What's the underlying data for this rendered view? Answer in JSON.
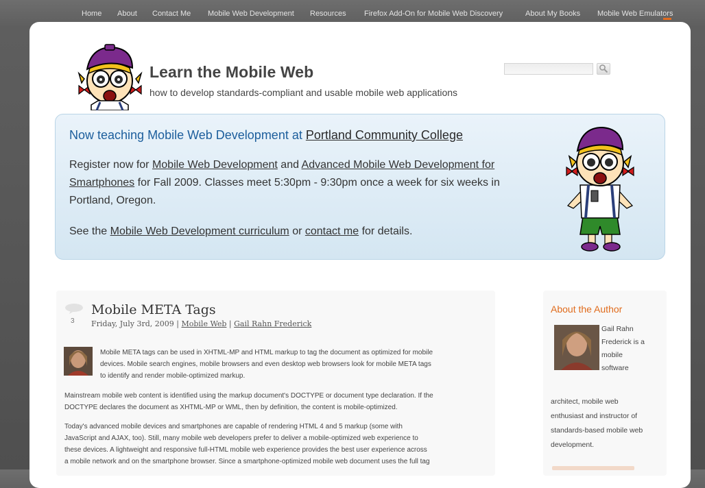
{
  "nav": {
    "home": "Home",
    "about": "About",
    "contact": "Contact Me",
    "mobile_dev": "Mobile Web Development",
    "resources": "Resources",
    "firefox": "Firefox Add-On for Mobile Web Discovery",
    "books": "About My Books",
    "emulators": "Mobile Web Emulators"
  },
  "header": {
    "title": "Learn the Mobile Web",
    "tagline": "how to develop standards-compliant and usable mobile web applications",
    "search_placeholder": ""
  },
  "promo": {
    "title_prefix": "Now teaching Mobile Web Development at ",
    "title_link": "Portland Community College",
    "p1_a": "Register now for ",
    "p1_link1": "Mobile Web Development",
    "p1_b": " and ",
    "p1_link2": "Advanced Mobile Web Development for Smartphones",
    "p1_c": " for Fall 2009. Classes meet 5:30pm - 9:30pm once a week for six weeks in Portland, Oregon.",
    "p2_a": "See the ",
    "p2_link1": "Mobile Web Development curriculum",
    "p2_b": " or ",
    "p2_link2": "contact me",
    "p2_c": " for details."
  },
  "post": {
    "comment_count": "3",
    "title": "Mobile META Tags",
    "date": "Friday, July 3rd, 2009",
    "sep": "|",
    "category": "Mobile Web",
    "author": "Gail Rahn Frederick",
    "p1_l1": "Mobile META tags can be used in XHTML-MP and HTML markup to tag the document as optimized for mobile",
    "p1_l2": "devices. Mobile search engines, mobile browsers and even desktop web browsers look for mobile META tags",
    "p1_l3": "to identify and render mobile-optimized markup.",
    "p2_l1": "Mainstream mobile web content is identified using the markup document's DOCTYPE or document type declaration. If the",
    "p2_l2": "DOCTYPE declares the document as XHTML-MP or WML, then by definition, the content is mobile-optimized.",
    "p3_l1": "Today's advanced mobile devices and smartphones are capable of rendering HTML 4 and 5 markup (some with",
    "p3_l2": "JavaScript and AJAX, too). Still, many mobile web developers prefer to deliver a mobile-optimized web experience to",
    "p3_l3": "these devices. A lightweight and responsive full-HTML mobile web experience provides the best user experience across",
    "p3_l4": "a mobile network and on the smartphone browser. Since a smartphone-optimized mobile web document uses the full tag"
  },
  "sidebar": {
    "title": "About the Author",
    "r1": "Gail Rahn",
    "r2": "Frederick is a",
    "r3": "mobile",
    "r4": "software",
    "f1": "architect, mobile web",
    "f2": "enthusiast and instructor of",
    "f3": "standards-based mobile web",
    "f4": "development."
  },
  "colors": {
    "accent": "#e06b1c",
    "promo_title": "#1c5e9c",
    "promo_bg": "#d4e6f2"
  },
  "icons": {
    "search": "magnifier-icon",
    "comments": "speech-bubble-icon"
  }
}
